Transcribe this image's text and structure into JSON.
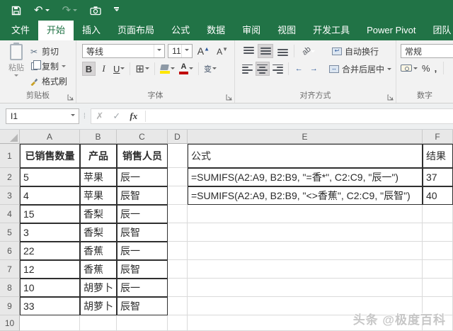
{
  "colors": {
    "excel_green": "#217346",
    "fill_yellow": "#ffe600",
    "font_red": "#c00000"
  },
  "qat": {
    "undo_glyph": "↶",
    "redo_glyph": "↷"
  },
  "tabs": [
    {
      "label": "文件"
    },
    {
      "label": "开始"
    },
    {
      "label": "插入"
    },
    {
      "label": "页面布局"
    },
    {
      "label": "公式"
    },
    {
      "label": "数据"
    },
    {
      "label": "审阅"
    },
    {
      "label": "视图"
    },
    {
      "label": "开发工具"
    },
    {
      "label": "Power Pivot"
    },
    {
      "label": "团队"
    }
  ],
  "ribbon": {
    "clipboard": {
      "group_label": "剪贴板",
      "paste": "粘贴",
      "cut": "剪切",
      "copy": "复制",
      "format_painter": "格式刷",
      "cut_glyph": "✂"
    },
    "font": {
      "group_label": "字体",
      "font_name": "等线",
      "font_size": "11",
      "bold": "B",
      "italic": "I",
      "underline": "U",
      "grow_font": "A",
      "shrink_font": "A",
      "border_glyph": "⊞",
      "font_color_a": "A",
      "phonetic": "变"
    },
    "alignment": {
      "group_label": "对齐方式",
      "wrap_text": "自动换行",
      "merge_center": "合并后居中",
      "orientation_glyph": "ab",
      "outdent_glyph": "←",
      "indent_glyph": "→",
      "merge_glyph": "↔"
    },
    "number": {
      "group_label": "数字",
      "format_value": "常规",
      "percent": "%",
      "comma": ","
    }
  },
  "formula_bar": {
    "name_box": "I1",
    "cancel_glyph": "✗",
    "enter_glyph": "✓",
    "fx_label": "fx",
    "handle_glyph": "⁞",
    "input_value": ""
  },
  "sheet": {
    "col_headers": [
      "A",
      "B",
      "C",
      "D",
      "E",
      "F"
    ],
    "row_headers": [
      "1",
      "2",
      "3",
      "4",
      "5",
      "6",
      "7",
      "8",
      "9",
      "10"
    ],
    "data_table": {
      "headers": [
        "已销售数量",
        "产品",
        "销售人员"
      ],
      "rows": [
        [
          "5",
          "苹果",
          "辰一"
        ],
        [
          "4",
          "苹果",
          "辰智"
        ],
        [
          "15",
          "香梨",
          "辰一"
        ],
        [
          "3",
          "香梨",
          "辰智"
        ],
        [
          "22",
          "香蕉",
          "辰一"
        ],
        [
          "12",
          "香蕉",
          "辰智"
        ],
        [
          "10",
          "胡萝卜",
          "辰一"
        ],
        [
          "33",
          "胡萝卜",
          "辰智"
        ]
      ]
    },
    "formula_table": {
      "headers": [
        "公式",
        "结果"
      ],
      "rows": [
        [
          "=SUMIFS(A2:A9, B2:B9, \"=香*\", C2:C9, \"辰一\")",
          "37"
        ],
        [
          "=SUMIFS(A2:A9, B2:B9, \"<>香蕉\", C2:C9, \"辰智\")",
          "40"
        ]
      ]
    }
  },
  "watermark": "头条 @极度百科"
}
